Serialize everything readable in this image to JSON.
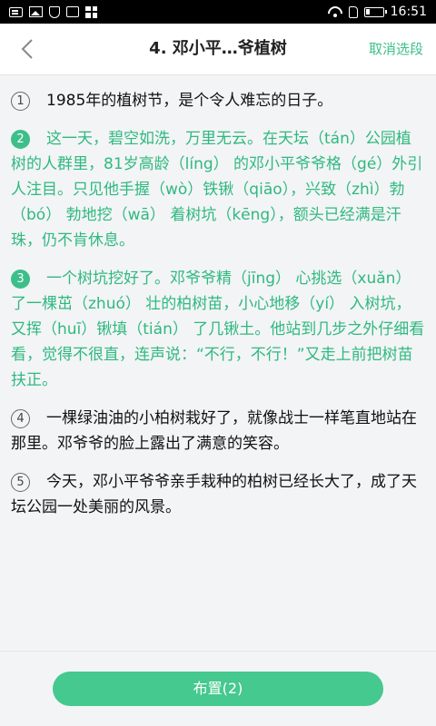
{
  "status_bar": {
    "time": "16:51"
  },
  "header": {
    "title": "4. 邓小平…爷植树",
    "cancel_label": "取消选段"
  },
  "paragraphs": [
    {
      "number": "1",
      "selected": false,
      "text": "1985年的植树节，是个令人难忘的日子。"
    },
    {
      "number": "2",
      "selected": true,
      "text": "这一天，碧空如洗，万里无云。在天坛（tán）公园植树的人群里，81岁高龄（líng） 的邓小平爷爷格（gé）外引人注目。只见他手握（wò）铁锹（qiāo），兴致（zhì）勃（bó） 勃地挖（wā） 着树坑（kēng），额头已经满是汗珠，仍不肯休息。"
    },
    {
      "number": "3",
      "selected": true,
      "text": "一个树坑挖好了。邓爷爷精（jīng） 心挑选（xuǎn） 了一棵茁（zhuó） 壮的柏树苗，小心地移（yí） 入树坑，又挥（huī）锹填（tián） 了几锹土。他站到几步之外仔细看看，觉得不很直，连声说：“不行，不行！”又走上前把树苗扶正。"
    },
    {
      "number": "4",
      "selected": false,
      "text": "一棵绿油油的小柏树栽好了，就像战士一样笔直地站在那里。邓爷爷的脸上露出了满意的笑容。"
    },
    {
      "number": "5",
      "selected": false,
      "text": "今天，邓小平爷爷亲手栽种的柏树已经长大了，成了天坛公园一处美丽的风景。"
    }
  ],
  "footer": {
    "assign_label": "布置(2)"
  },
  "colors": {
    "accent": "#3dbf8a",
    "selected_text": "#2fb97f",
    "button": "#45c98f"
  }
}
